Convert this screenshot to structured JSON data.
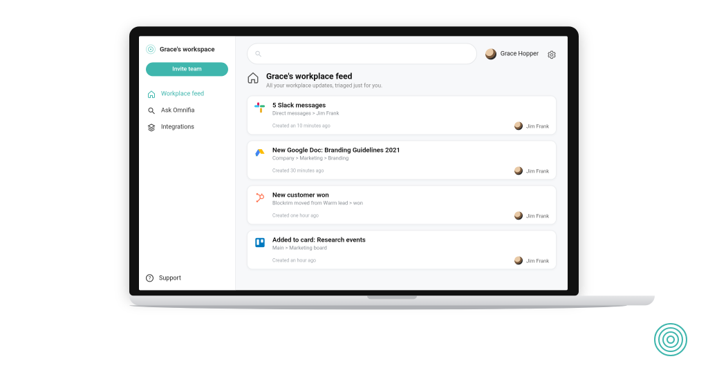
{
  "sidebar": {
    "workspace_name": "Grace's workspace",
    "invite_label": "Invite team",
    "items": [
      {
        "label": "Workplace feed"
      },
      {
        "label": "Ask Omnifia"
      },
      {
        "label": "Integrations"
      }
    ],
    "support_label": "Support"
  },
  "topbar": {
    "search_placeholder": "",
    "user_name": "Grace Hopper"
  },
  "page": {
    "title": "Grace's workplace feed",
    "subtitle": "All your workplace updates, triaged just for you."
  },
  "feed": [
    {
      "app": "slack",
      "title": "5 Slack messages",
      "subtitle": "Direct messages > Jim Frank",
      "created": "Created an 10 minutes ago",
      "author": "Jim Frank"
    },
    {
      "app": "gdrive",
      "title": "New Google Doc: Branding Guidelines 2021",
      "subtitle": "Company > Marketing > Branding",
      "created": "Created 30 minutes ago",
      "author": "Jim Frank"
    },
    {
      "app": "hubspot",
      "title": "New customer won",
      "subtitle": "Blockrim moved from Warm lead > won",
      "created": "Created one hour ago",
      "author": "Jim Frank"
    },
    {
      "app": "trello",
      "title": "Added to card: Research events",
      "subtitle": "Main > Marketing board",
      "created": "Created an hour ago",
      "author": "Jim Frank"
    }
  ],
  "colors": {
    "accent": "#3fb6ad"
  }
}
